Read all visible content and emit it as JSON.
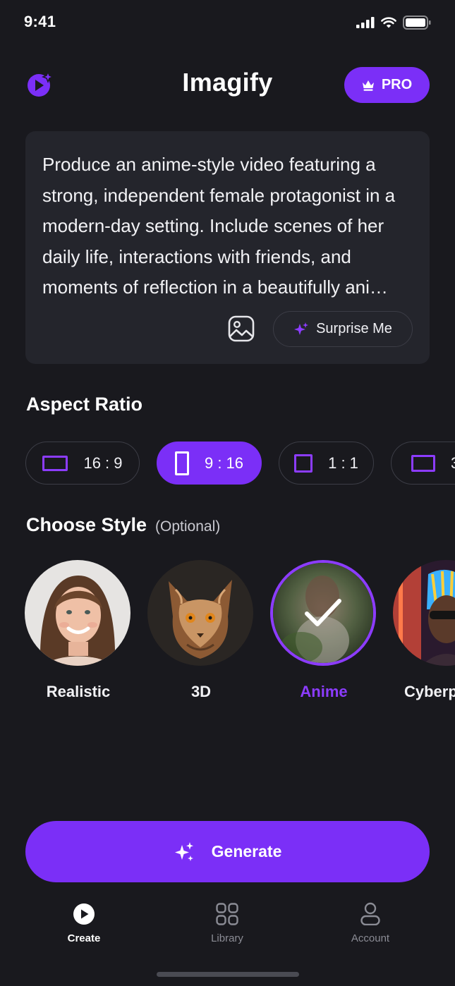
{
  "status_bar": {
    "time": "9:41"
  },
  "header": {
    "title": "Imagify",
    "pro_label": "PRO"
  },
  "prompt": {
    "text": "Produce an anime-style video featuring a strong, independent female protagonist in a modern-day setting. Include scenes of her daily life, interactions with friends, and moments of reflection in a beautifully ani…",
    "surprise_label": "Surprise Me"
  },
  "aspect_ratio": {
    "title": "Aspect Ratio",
    "options": [
      {
        "label": "16 : 9",
        "active": false
      },
      {
        "label": "9 : 16",
        "active": true
      },
      {
        "label": "1 : 1",
        "active": false
      },
      {
        "label": "3",
        "active": false
      }
    ]
  },
  "style": {
    "title": "Choose Style",
    "optional_label": "(Optional)",
    "options": [
      {
        "label": "Realistic",
        "selected": false
      },
      {
        "label": "3D",
        "selected": false
      },
      {
        "label": "Anime",
        "selected": true
      },
      {
        "label": "Cyberp",
        "selected": false
      }
    ]
  },
  "generate_label": "Generate",
  "tab_bar": {
    "tabs": [
      {
        "label": "Create",
        "active": true,
        "icon": "play-circle-icon"
      },
      {
        "label": "Library",
        "active": false,
        "icon": "grid-icon"
      },
      {
        "label": "Account",
        "active": false,
        "icon": "user-icon"
      }
    ]
  },
  "colors": {
    "accent": "#7b2ff7",
    "background": "#19191e",
    "card": "#24252c"
  }
}
